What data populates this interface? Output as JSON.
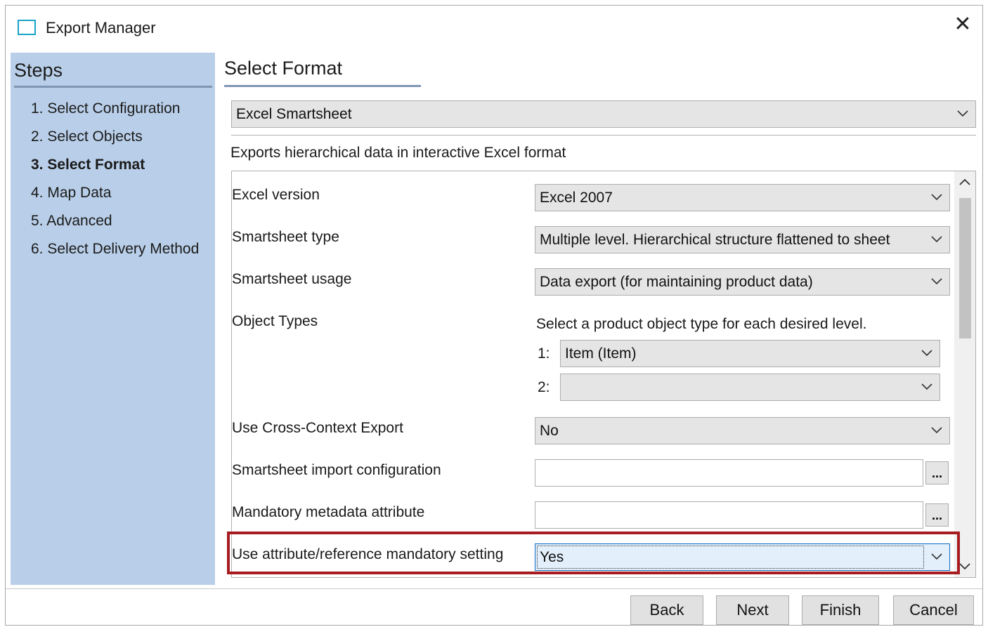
{
  "window": {
    "title": "Export Manager"
  },
  "steps": {
    "header": "Steps",
    "items": [
      {
        "label": "1. Select Configuration",
        "active": false
      },
      {
        "label": "2. Select Objects",
        "active": false
      },
      {
        "label": "3. Select Format",
        "active": true
      },
      {
        "label": "4. Map Data",
        "active": false
      },
      {
        "label": "5. Advanced",
        "active": false
      },
      {
        "label": "6. Select Delivery Method",
        "active": false
      }
    ]
  },
  "main": {
    "title": "Select Format",
    "format": {
      "selected": "Excel Smartsheet"
    },
    "description": "Exports hierarchical data in interactive Excel format",
    "properties": {
      "excel_version": {
        "label": "Excel version",
        "value": "Excel 2007"
      },
      "smartsheet_type": {
        "label": "Smartsheet type",
        "value": "Multiple level. Hierarchical structure flattened to sheet"
      },
      "smartsheet_usage": {
        "label": "Smartsheet usage",
        "value": "Data export (for maintaining product data)"
      },
      "object_types": {
        "label": "Object Types",
        "hint": "Select a product object type for each desired level.",
        "levels": [
          {
            "num": "1:",
            "value": "Item (Item)"
          },
          {
            "num": "2:",
            "value": ""
          }
        ]
      },
      "cross_context": {
        "label": "Use Cross-Context Export",
        "value": "No"
      },
      "import_config": {
        "label": "Smartsheet import configuration",
        "value": "",
        "button": "..."
      },
      "mandatory_meta": {
        "label": "Mandatory metadata attribute",
        "value": "",
        "button": "..."
      },
      "mandatory_setting": {
        "label": "Use attribute/reference mandatory setting",
        "value": "Yes"
      }
    }
  },
  "footer": {
    "back": "Back",
    "next": "Next",
    "finish": "Finish",
    "cancel": "Cancel"
  },
  "colors": {
    "steps_bg": "#b9cfe9",
    "highlight": "#a61c21",
    "icon_accent": "#1aa3c9"
  },
  "icons": {
    "close": "close-icon",
    "chevron": "chevron-down-icon",
    "scroll_up": "chevron-up-icon",
    "scroll_down": "chevron-down-icon"
  }
}
